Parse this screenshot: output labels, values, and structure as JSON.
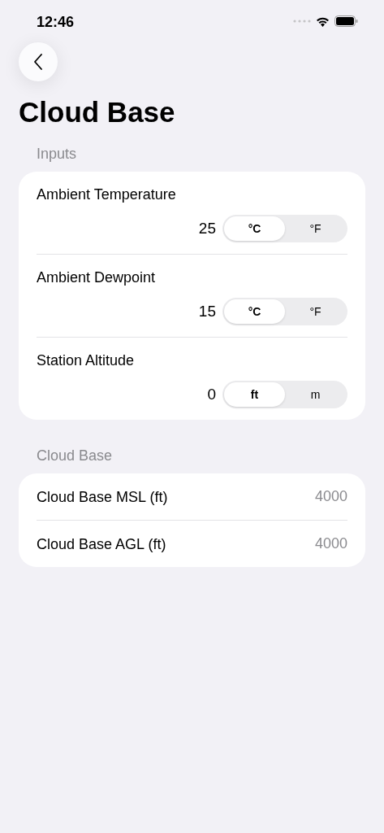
{
  "status_bar": {
    "time": "12:46"
  },
  "title": "Cloud Base",
  "inputs": {
    "header": "Inputs",
    "rows": [
      {
        "label": "Ambient Temperature",
        "value": "25",
        "units": [
          {
            "label": "°C",
            "selected": true
          },
          {
            "label": "°F",
            "selected": false
          }
        ]
      },
      {
        "label": "Ambient Dewpoint",
        "value": "15",
        "units": [
          {
            "label": "°C",
            "selected": true
          },
          {
            "label": "°F",
            "selected": false
          }
        ]
      },
      {
        "label": "Station Altitude",
        "value": "0",
        "units": [
          {
            "label": "ft",
            "selected": true
          },
          {
            "label": "m",
            "selected": false
          }
        ]
      }
    ]
  },
  "results": {
    "header": "Cloud Base",
    "rows": [
      {
        "label": "Cloud Base MSL (ft)",
        "value": "4000"
      },
      {
        "label": "Cloud Base AGL (ft)",
        "value": "4000"
      }
    ]
  }
}
